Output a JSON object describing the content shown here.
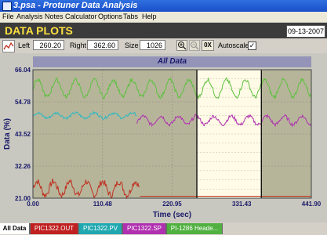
{
  "window": {
    "title": "3.psa - Protuner Data  Analysis"
  },
  "menu": [
    "File",
    "Analysis",
    "Notes",
    "Calculator",
    "Options",
    "Tabs",
    "Help"
  ],
  "header": {
    "title": "DATA PLOTS",
    "date": "09-13-2007"
  },
  "toolbar": {
    "left_label": "Left",
    "left_value": "260.20",
    "right_label": "Right",
    "right_value": "362.60",
    "size_label": "Size",
    "size_value": "1026",
    "autoscale_label": "Autoscale",
    "autoscale_checked": "✓",
    "reset_label": "0X"
  },
  "chart_data": {
    "type": "line",
    "title": "All Data",
    "xlabel": "Time (sec)",
    "ylabel": "Data (%)",
    "xlim": [
      0.0,
      441.9
    ],
    "ylim": [
      21.0,
      66.04
    ],
    "x_ticks": [
      "0.00",
      "110.48",
      "220.95",
      "331.43",
      "441.90"
    ],
    "y_ticks": [
      "21.00",
      "32.26",
      "43.52",
      "54.78",
      "66.04"
    ],
    "selection": {
      "left": 260.2,
      "right": 362.6
    },
    "series": [
      {
        "name": "PIC1322.OUT",
        "color": "#c03020",
        "segments": [
          {
            "x0": 0,
            "x1": 170,
            "center": 24.5,
            "amp": 2.4,
            "period": 26,
            "noise": 1.2
          },
          {
            "x0": 170,
            "x1": 441.9,
            "center": 21.7,
            "amp": 0,
            "period": 20,
            "noise": 0
          }
        ]
      },
      {
        "name": "PIC1322.PV",
        "color": "#30b8c0",
        "segments": [
          {
            "x0": 0,
            "x1": 165,
            "center": 50.0,
            "amp": 0.9,
            "period": 30,
            "noise": 0.5
          }
        ]
      },
      {
        "name": "PIC1322.SP",
        "color": "#b030b0",
        "segments": [
          {
            "x0": 165,
            "x1": 441.9,
            "center": 48.3,
            "amp": 1.5,
            "period": 28,
            "noise": 0.6
          }
        ]
      },
      {
        "name": "PI-1286 Heade...",
        "color": "#60c040",
        "segments": [
          {
            "x0": 0,
            "x1": 441.9,
            "center": 59.5,
            "amp": 3.0,
            "period": 30,
            "noise": 0.7
          }
        ]
      }
    ]
  },
  "tabs": [
    "All Data",
    "PIC1322.OUT",
    "PIC1322.PV",
    "PIC1322.SP",
    "PI-1286 Heade..."
  ],
  "colors": {
    "accent": "#1a4fc8",
    "header_text": "#ffe040",
    "plot_bg": "#b6b59a",
    "selection_bg": "#fffbe6"
  }
}
